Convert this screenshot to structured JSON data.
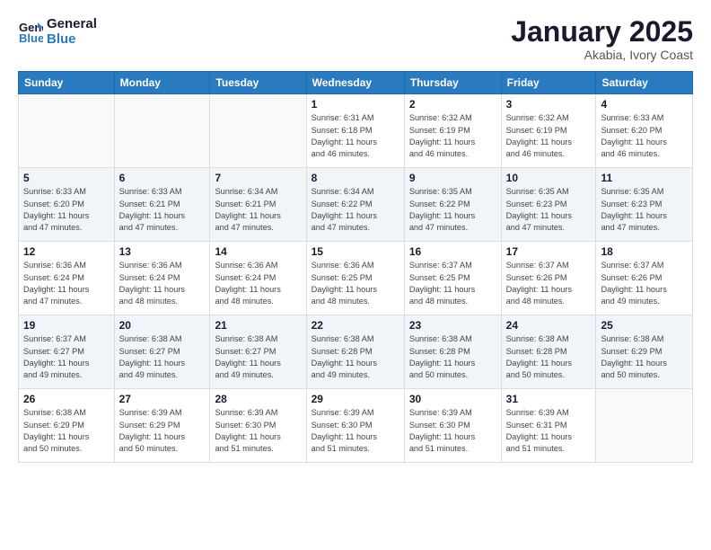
{
  "logo": {
    "line1": "General",
    "line2": "Blue"
  },
  "title": "January 2025",
  "location": "Akabia, Ivory Coast",
  "weekdays": [
    "Sunday",
    "Monday",
    "Tuesday",
    "Wednesday",
    "Thursday",
    "Friday",
    "Saturday"
  ],
  "weeks": [
    [
      {
        "day": "",
        "info": ""
      },
      {
        "day": "",
        "info": ""
      },
      {
        "day": "",
        "info": ""
      },
      {
        "day": "1",
        "info": "Sunrise: 6:31 AM\nSunset: 6:18 PM\nDaylight: 11 hours\nand 46 minutes."
      },
      {
        "day": "2",
        "info": "Sunrise: 6:32 AM\nSunset: 6:19 PM\nDaylight: 11 hours\nand 46 minutes."
      },
      {
        "day": "3",
        "info": "Sunrise: 6:32 AM\nSunset: 6:19 PM\nDaylight: 11 hours\nand 46 minutes."
      },
      {
        "day": "4",
        "info": "Sunrise: 6:33 AM\nSunset: 6:20 PM\nDaylight: 11 hours\nand 46 minutes."
      }
    ],
    [
      {
        "day": "5",
        "info": "Sunrise: 6:33 AM\nSunset: 6:20 PM\nDaylight: 11 hours\nand 47 minutes."
      },
      {
        "day": "6",
        "info": "Sunrise: 6:33 AM\nSunset: 6:21 PM\nDaylight: 11 hours\nand 47 minutes."
      },
      {
        "day": "7",
        "info": "Sunrise: 6:34 AM\nSunset: 6:21 PM\nDaylight: 11 hours\nand 47 minutes."
      },
      {
        "day": "8",
        "info": "Sunrise: 6:34 AM\nSunset: 6:22 PM\nDaylight: 11 hours\nand 47 minutes."
      },
      {
        "day": "9",
        "info": "Sunrise: 6:35 AM\nSunset: 6:22 PM\nDaylight: 11 hours\nand 47 minutes."
      },
      {
        "day": "10",
        "info": "Sunrise: 6:35 AM\nSunset: 6:23 PM\nDaylight: 11 hours\nand 47 minutes."
      },
      {
        "day": "11",
        "info": "Sunrise: 6:35 AM\nSunset: 6:23 PM\nDaylight: 11 hours\nand 47 minutes."
      }
    ],
    [
      {
        "day": "12",
        "info": "Sunrise: 6:36 AM\nSunset: 6:24 PM\nDaylight: 11 hours\nand 47 minutes."
      },
      {
        "day": "13",
        "info": "Sunrise: 6:36 AM\nSunset: 6:24 PM\nDaylight: 11 hours\nand 48 minutes."
      },
      {
        "day": "14",
        "info": "Sunrise: 6:36 AM\nSunset: 6:24 PM\nDaylight: 11 hours\nand 48 minutes."
      },
      {
        "day": "15",
        "info": "Sunrise: 6:36 AM\nSunset: 6:25 PM\nDaylight: 11 hours\nand 48 minutes."
      },
      {
        "day": "16",
        "info": "Sunrise: 6:37 AM\nSunset: 6:25 PM\nDaylight: 11 hours\nand 48 minutes."
      },
      {
        "day": "17",
        "info": "Sunrise: 6:37 AM\nSunset: 6:26 PM\nDaylight: 11 hours\nand 48 minutes."
      },
      {
        "day": "18",
        "info": "Sunrise: 6:37 AM\nSunset: 6:26 PM\nDaylight: 11 hours\nand 49 minutes."
      }
    ],
    [
      {
        "day": "19",
        "info": "Sunrise: 6:37 AM\nSunset: 6:27 PM\nDaylight: 11 hours\nand 49 minutes."
      },
      {
        "day": "20",
        "info": "Sunrise: 6:38 AM\nSunset: 6:27 PM\nDaylight: 11 hours\nand 49 minutes."
      },
      {
        "day": "21",
        "info": "Sunrise: 6:38 AM\nSunset: 6:27 PM\nDaylight: 11 hours\nand 49 minutes."
      },
      {
        "day": "22",
        "info": "Sunrise: 6:38 AM\nSunset: 6:28 PM\nDaylight: 11 hours\nand 49 minutes."
      },
      {
        "day": "23",
        "info": "Sunrise: 6:38 AM\nSunset: 6:28 PM\nDaylight: 11 hours\nand 50 minutes."
      },
      {
        "day": "24",
        "info": "Sunrise: 6:38 AM\nSunset: 6:28 PM\nDaylight: 11 hours\nand 50 minutes."
      },
      {
        "day": "25",
        "info": "Sunrise: 6:38 AM\nSunset: 6:29 PM\nDaylight: 11 hours\nand 50 minutes."
      }
    ],
    [
      {
        "day": "26",
        "info": "Sunrise: 6:38 AM\nSunset: 6:29 PM\nDaylight: 11 hours\nand 50 minutes."
      },
      {
        "day": "27",
        "info": "Sunrise: 6:39 AM\nSunset: 6:29 PM\nDaylight: 11 hours\nand 50 minutes."
      },
      {
        "day": "28",
        "info": "Sunrise: 6:39 AM\nSunset: 6:30 PM\nDaylight: 11 hours\nand 51 minutes."
      },
      {
        "day": "29",
        "info": "Sunrise: 6:39 AM\nSunset: 6:30 PM\nDaylight: 11 hours\nand 51 minutes."
      },
      {
        "day": "30",
        "info": "Sunrise: 6:39 AM\nSunset: 6:30 PM\nDaylight: 11 hours\nand 51 minutes."
      },
      {
        "day": "31",
        "info": "Sunrise: 6:39 AM\nSunset: 6:31 PM\nDaylight: 11 hours\nand 51 minutes."
      },
      {
        "day": "",
        "info": ""
      }
    ]
  ]
}
